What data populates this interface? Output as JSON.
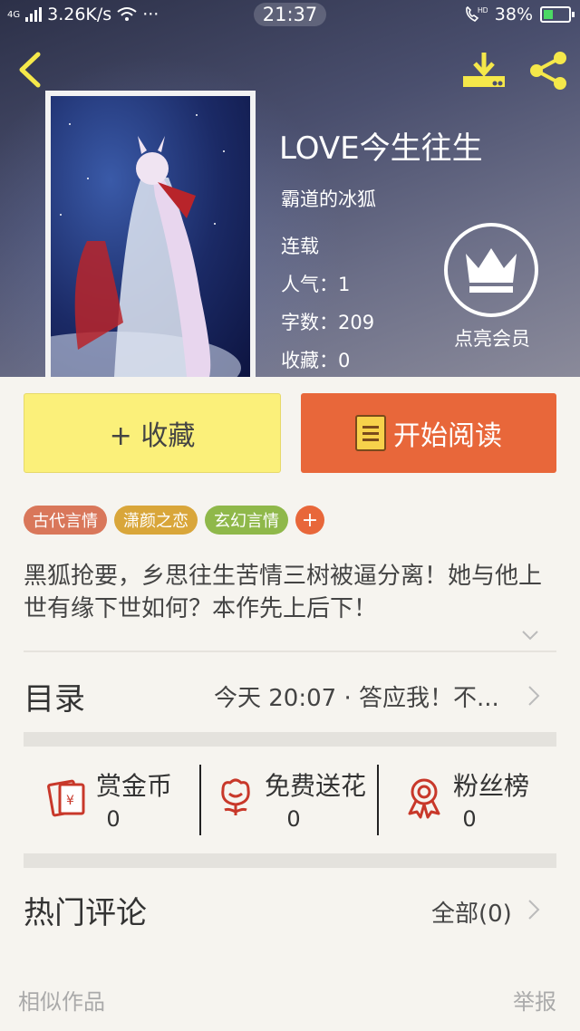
{
  "status_bar": {
    "network": "4G",
    "speed": "3.26K/s",
    "more": "···",
    "time": "21:37",
    "battery": "38%",
    "battery_level": 0.38
  },
  "book": {
    "title": "LOVE今生往生",
    "author": "霸道的冰狐",
    "status": "连载",
    "popularity": "人气：1",
    "word_count": "字数：209",
    "favorites": "收藏：0"
  },
  "vip": {
    "label": "点亮会员"
  },
  "actions": {
    "favorite": "+ 收藏",
    "read": "开始阅读"
  },
  "tags": [
    {
      "label": "古代言情",
      "color": "#d9775a"
    },
    {
      "label": "潇颜之恋",
      "color": "#d9a63a"
    },
    {
      "label": "玄幻言情",
      "color": "#8fb84a"
    }
  ],
  "tag_add": "+",
  "description": "黑狐抢要，乡思往生苦情三树被逼分离！她与他上世有缘下世如何？本作先上后下！",
  "toc": {
    "label": "目录",
    "latest": "今天 20:07 · 答应我！不..."
  },
  "stats": [
    {
      "name": "赏金币",
      "count": "0",
      "icon": "red-envelope-icon"
    },
    {
      "name": "免费送花",
      "count": "0",
      "icon": "flower-icon"
    },
    {
      "name": "粉丝榜",
      "count": "0",
      "icon": "medal-icon"
    }
  ],
  "comments": {
    "label": "热门评论",
    "all": "全部(0)"
  },
  "footer": {
    "similar": "相似作品",
    "report": "举报"
  },
  "colors": {
    "accent": "#e8673a",
    "fav_button": "#fbf07a",
    "icon_yellow": "#f5e84a",
    "icon_red": "#c8382a"
  }
}
